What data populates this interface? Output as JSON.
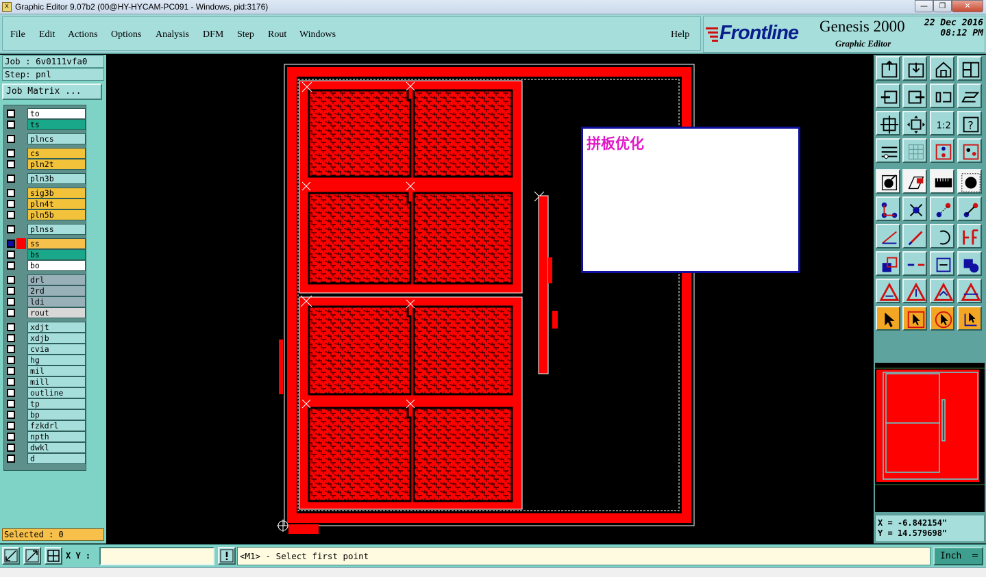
{
  "window": {
    "title": "Graphic Editor 9.07b2 (00@HY-HYCAM-PC091 - Windows, pid:3176)",
    "app_icon": "X"
  },
  "window_controls": {
    "minimize": "—",
    "maximize": "❐",
    "close": "✕"
  },
  "menu": {
    "items": [
      "File",
      "Edit",
      "Actions",
      "Options",
      "Analysis",
      "DFM",
      "Step",
      "Rout",
      "Windows"
    ],
    "help": "Help"
  },
  "brand": {
    "logo": "Frontline",
    "product": "Genesis 2000",
    "subtitle": "Graphic Editor",
    "date_line1": "22 Dec 2016",
    "date_line2": "08:12 PM"
  },
  "job": {
    "job_label": "Job : 6v0111vfa0",
    "step_label": "Step: pnl",
    "matrix_button": "Job Matrix ..."
  },
  "layers": [
    {
      "name": "to",
      "color": "#ffffff"
    },
    {
      "name": "ts",
      "color": "#19a88a"
    },
    {
      "name": "plncs",
      "color": "#a6dedc"
    },
    {
      "name": "cs",
      "color": "#f2c23a"
    },
    {
      "name": "pln2t",
      "color": "#f2c23a"
    },
    {
      "name": "pln3b",
      "color": "#a6dedc"
    },
    {
      "name": "sig3b",
      "color": "#f2c23a"
    },
    {
      "name": "pln4t",
      "color": "#f2c23a"
    },
    {
      "name": "pln5b",
      "color": "#f2c23a"
    },
    {
      "name": "plnss",
      "color": "#a6dedc"
    },
    {
      "name": "ss",
      "color": "#f7c04a",
      "active": true
    },
    {
      "name": "bs",
      "color": "#19a88a"
    },
    {
      "name": "bo",
      "color": "#ffffff"
    },
    {
      "name": "drl",
      "color": "#98b0b8"
    },
    {
      "name": "2rd",
      "color": "#98b0b8"
    },
    {
      "name": "ldi",
      "color": "#98b0b8"
    },
    {
      "name": "rout",
      "color": "#d8d8d8"
    },
    {
      "name": "xdjt",
      "color": "#a6dedc"
    },
    {
      "name": "xdjb",
      "color": "#a6dedc"
    },
    {
      "name": "cvia",
      "color": "#a6dedc"
    },
    {
      "name": "hg",
      "color": "#a6dedc"
    },
    {
      "name": "mil",
      "color": "#a6dedc"
    },
    {
      "name": "mill",
      "color": "#a6dedc"
    },
    {
      "name": "outline",
      "color": "#a6dedc"
    },
    {
      "name": "tp",
      "color": "#a6dedc"
    },
    {
      "name": "bp",
      "color": "#a6dedc"
    },
    {
      "name": "fzkdrl",
      "color": "#a6dedc"
    },
    {
      "name": "npth",
      "color": "#a6dedc"
    },
    {
      "name": "dwkl",
      "color": "#a6dedc"
    },
    {
      "name": "d",
      "color": "#a6dedc"
    }
  ],
  "selected": {
    "label": "Selected : 0"
  },
  "popup": {
    "text": "拼板优化"
  },
  "coords": {
    "x": "X  = -6.842154\"",
    "y": "Y  = 14.579698\""
  },
  "status": {
    "xy_label": "X Y :",
    "xy_value": "",
    "message": "<M1> - Select first point",
    "unit": "Inch"
  },
  "colors": {
    "board_red": "#ff0000",
    "panel_bg": "#a6dedc"
  }
}
